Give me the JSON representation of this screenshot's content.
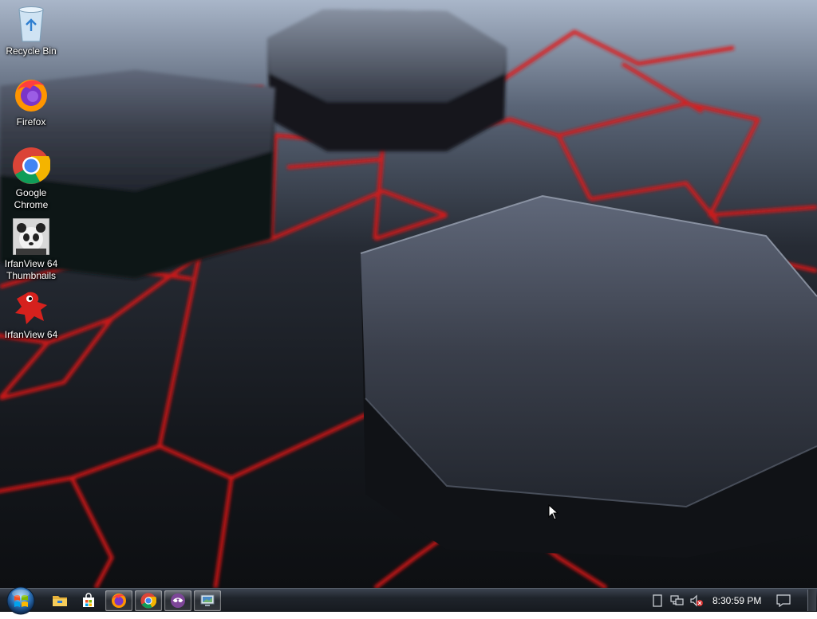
{
  "desktop": {
    "icons": [
      {
        "label": "Recycle Bin",
        "icon": "recycle-bin-icon"
      },
      {
        "label": "Firefox",
        "icon": "firefox-icon"
      },
      {
        "label": "Google\nChrome",
        "icon": "chrome-icon"
      },
      {
        "label": "IrfanView 64\nThumbnails",
        "icon": "irfanview-thumbnails-icon"
      },
      {
        "label": "IrfanView 64",
        "icon": "irfanview-icon"
      }
    ]
  },
  "taskbar": {
    "start_icon": "windows-logo-icon",
    "pinned": [
      {
        "icon": "file-explorer-icon",
        "running": false
      },
      {
        "icon": "store-icon",
        "running": false
      },
      {
        "icon": "firefox-icon",
        "running": true
      },
      {
        "icon": "chrome-icon",
        "running": true
      },
      {
        "icon": "tor-browser-icon",
        "running": true
      },
      {
        "icon": "remote-desktop-icon",
        "running": true
      }
    ],
    "tray": {
      "icons": [
        "tablet-icon",
        "network-icon",
        "volume-muted-icon",
        "action-center-icon"
      ],
      "clock": "8:30:59 PM"
    }
  },
  "colors": {
    "neon_red": "#e01818",
    "taskbar": "#1f242b"
  }
}
